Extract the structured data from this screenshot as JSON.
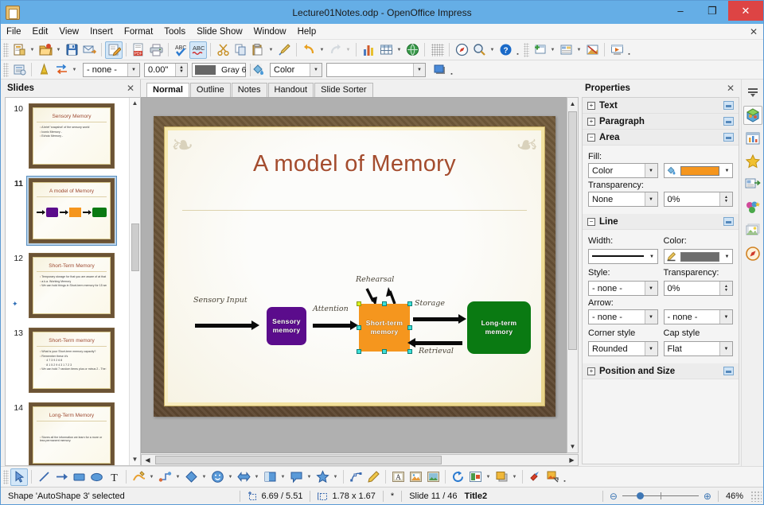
{
  "window": {
    "title": "Lecture01Notes.odp - OpenOffice Impress",
    "app_icon": "impress-icon",
    "minimize": "–",
    "maximize": "❐",
    "close": "✕"
  },
  "menubar": {
    "items": [
      "File",
      "Edit",
      "View",
      "Insert",
      "Format",
      "Tools",
      "Slide Show",
      "Window",
      "Help"
    ],
    "doc_close": "✕"
  },
  "toolbar_standard": {
    "buttons": [
      {
        "name": "new-document",
        "icon": "new-doc-icon",
        "dropdown": true,
        "active": false
      },
      {
        "name": "open-document",
        "icon": "open-folder-icon",
        "dropdown": true,
        "active": false
      },
      {
        "name": "save-document",
        "icon": "save-disk-icon",
        "dropdown": false,
        "active": false
      },
      {
        "name": "email-document",
        "icon": "email-icon",
        "dropdown": false,
        "active": false
      },
      {
        "name": "edit-file",
        "icon": "edit-file-icon",
        "dropdown": false,
        "active": true
      },
      {
        "name": "export-pdf",
        "icon": "pdf-icon",
        "dropdown": false,
        "active": false
      },
      {
        "name": "print-document",
        "icon": "printer-icon",
        "dropdown": false,
        "active": false
      },
      {
        "name": "spelling",
        "icon": "spellcheck-icon",
        "dropdown": false,
        "active": false
      },
      {
        "name": "autospellcheck",
        "icon": "autospell-icon",
        "dropdown": false,
        "active": true
      },
      {
        "name": "cut",
        "icon": "scissors-icon",
        "dropdown": false,
        "active": false
      },
      {
        "name": "copy",
        "icon": "copy-icon",
        "dropdown": false,
        "active": false
      },
      {
        "name": "paste",
        "icon": "paste-icon",
        "dropdown": true,
        "active": false
      },
      {
        "name": "clone-formatting",
        "icon": "paintbrush-icon",
        "dropdown": false,
        "active": false
      },
      {
        "name": "undo",
        "icon": "undo-icon",
        "dropdown": true,
        "active": false
      },
      {
        "name": "redo",
        "icon": "redo-icon",
        "dropdown": true,
        "active": false,
        "disabled": true
      },
      {
        "name": "insert-chart",
        "icon": "chart-icon",
        "dropdown": false,
        "active": false
      },
      {
        "name": "insert-table",
        "icon": "table-icon",
        "dropdown": true,
        "active": false
      },
      {
        "name": "insert-image",
        "icon": "image-globe-icon",
        "dropdown": false,
        "active": false
      },
      {
        "name": "display-grid",
        "icon": "grid-icon",
        "dropdown": false,
        "active": false,
        "disabled": true
      },
      {
        "name": "navigator",
        "icon": "compass-icon",
        "dropdown": false,
        "active": false
      },
      {
        "name": "zoom",
        "icon": "magnifier-icon",
        "dropdown": true,
        "active": false
      },
      {
        "name": "help",
        "icon": "help-icon",
        "dropdown": false,
        "active": false
      },
      {
        "name": "new-slide",
        "icon": "new-slide-icon",
        "dropdown": true,
        "active": false
      },
      {
        "name": "slide-layout",
        "icon": "slide-layout-icon",
        "dropdown": true,
        "active": false
      },
      {
        "name": "slide-design",
        "icon": "slide-design-icon",
        "dropdown": false,
        "active": false
      },
      {
        "name": "start-slideshow",
        "icon": "slideshow-icon",
        "dropdown": false,
        "active": false
      }
    ]
  },
  "toolbar_line_fill": {
    "style_button": "styles-icon",
    "fontwork_button": "fontwork-icon",
    "position_button": "arrange-icon",
    "line_style": "- none -",
    "line_width": "0.00\"",
    "line_color_name": "Gray 6",
    "line_color_hex": "#666666",
    "fill_icon": "bucket-icon",
    "fill_type": "Color",
    "fill_color": "",
    "shadow_button": "shadow-icon"
  },
  "slides_panel": {
    "title": "Slides",
    "close": "✕",
    "scroll_up": "▲",
    "scroll_down": "▼",
    "slides": [
      {
        "number": "10",
        "title": "Sensory Memory",
        "selected": false,
        "type": "bullets",
        "bullets": [
          {
            "text": "A brief 'snapshot' of the sensory world",
            "level": 1
          },
          {
            "text": "Iconic Memory -",
            "level": 1
          },
          {
            "text": "Echoic Memory -",
            "level": 1
          }
        ]
      },
      {
        "number": "11",
        "title": "A model of Memory",
        "selected": true,
        "type": "diagram"
      },
      {
        "number": "12",
        "title": "Short-Term Memory",
        "selected": false,
        "type": "bullets",
        "has_animation": true,
        "bullets": [
          {
            "text": "Temporary storage for that you are aware of at that time.",
            "level": 1
          },
          {
            "text": "a.k.a. Working Memory",
            "level": 1
          },
          {
            "text": "We can hold things in Short-term memory for 15 seconds - if the data is not rehearsed.",
            "level": 1
          }
        ]
      },
      {
        "number": "13",
        "title": "Short-Term memory",
        "selected": false,
        "type": "bullets",
        "bullets": [
          {
            "text": "What is your Short-term memory capacity?",
            "level": 1
          },
          {
            "text": "Remember these #'s",
            "level": 1
          },
          {
            "text": "4 7 3 9 2 6 8",
            "level": 2
          },
          {
            "text": "8 1 5 2 9 4 3 1 7 2 3",
            "level": 2
          },
          {
            "text": "We can hold 7 random items plus or minus 2 - The Magic Number Seven",
            "level": 1
          }
        ]
      },
      {
        "number": "14",
        "title": "Long-Term Memory",
        "selected": false,
        "type": "bullets",
        "bullets": [
          {
            "text": "Stores all the information we learn for a more or less permanent memory.",
            "level": 1
          }
        ]
      }
    ]
  },
  "view_tabs": {
    "tabs": [
      "Normal",
      "Outline",
      "Notes",
      "Handout",
      "Slide Sorter"
    ],
    "active": "Normal"
  },
  "slide_canvas": {
    "title": "A model of Memory",
    "title_color": "#a44c2e",
    "frame_color": "#6b5335",
    "ornament_glyph": "❧",
    "diagram": {
      "boxes": [
        {
          "name": "sensory-memory-box",
          "label": "Sensory memory",
          "color": "#5b0c8c",
          "shape": "rounded"
        },
        {
          "name": "short-term-memory-box",
          "label": "Short-term memory",
          "color": "#f5961e",
          "shape": "rect",
          "selected": true
        },
        {
          "name": "long-term-memory-box",
          "label": "Long-term memory",
          "color": "#0a7a12",
          "shape": "rounded"
        }
      ],
      "labels": [
        {
          "name": "sensory-input-label",
          "text": "Sensory Input"
        },
        {
          "name": "attention-label",
          "text": "Attention"
        },
        {
          "name": "rehearsal-label",
          "text": "Rehearsal"
        },
        {
          "name": "storage-label",
          "text": "Storage"
        },
        {
          "name": "retrieval-label",
          "text": "Retrieval"
        }
      ]
    }
  },
  "properties_sidebar": {
    "title": "Properties",
    "close": "✕",
    "sections": [
      {
        "name": "Text",
        "expanded": false,
        "marker": "+"
      },
      {
        "name": "Paragraph",
        "expanded": false,
        "marker": "+"
      },
      {
        "name": "Area",
        "expanded": true,
        "marker": "−"
      },
      {
        "name": "Line",
        "expanded": true,
        "marker": "−"
      },
      {
        "name": "Position and Size",
        "expanded": false,
        "marker": "+"
      }
    ],
    "area": {
      "fill_label": "Fill:",
      "fill_type": "Color",
      "fill_color_hex": "#f5961e",
      "fill_color_icon": "fill-bucket-icon",
      "transparency_label": "Transparency:",
      "transparency_type": "None",
      "transparency_value": "0%"
    },
    "line": {
      "width_label": "Width:",
      "color_label": "Color:",
      "line_color_hex": "#6e6e6e",
      "line_color_icon": "line-color-pencil-icon",
      "style_label": "Style:",
      "style_value": "- none -",
      "transparency_label": "Transparency:",
      "transparency_value": "0%",
      "arrow_label": "Arrow:",
      "arrow_start": "- none -",
      "arrow_end": "- none -",
      "corner_style_label": "Corner style",
      "corner_style_value": "Rounded",
      "cap_style_label": "Cap style",
      "cap_style_value": "Flat"
    },
    "tabs": [
      {
        "name": "sidebar-settings",
        "icon": "sidebar-menu-icon",
        "active": false
      },
      {
        "name": "properties-tab",
        "icon": "properties-cube-icon",
        "active": true
      },
      {
        "name": "slide-transition-tab",
        "icon": "transition-icon",
        "active": false
      },
      {
        "name": "custom-animation-tab",
        "icon": "star-icon",
        "active": false
      },
      {
        "name": "master-slides-tab",
        "icon": "master-slides-icon",
        "active": false
      },
      {
        "name": "gallery-tab",
        "icon": "gallery-icon",
        "active": false
      },
      {
        "name": "styles-tab",
        "icon": "styles-gallery-icon",
        "active": false
      },
      {
        "name": "navigator-tab",
        "icon": "navigator-compass-icon",
        "active": false
      }
    ]
  },
  "draw_toolbar": {
    "buttons": [
      {
        "name": "select-tool",
        "icon": "cursor-arrow-icon",
        "active": true,
        "dropdown": false
      },
      {
        "name": "line-tool",
        "icon": "line-icon",
        "active": false,
        "dropdown": false
      },
      {
        "name": "arrow-tool",
        "icon": "arrow-icon",
        "active": false,
        "dropdown": false
      },
      {
        "name": "rectangle-tool",
        "icon": "rectangle-icon",
        "active": false,
        "dropdown": false
      },
      {
        "name": "ellipse-tool",
        "icon": "ellipse-icon",
        "active": false,
        "dropdown": false
      },
      {
        "name": "text-tool",
        "icon": "text-T-icon",
        "active": false,
        "dropdown": false
      },
      {
        "name": "curve-tool",
        "icon": "curve-pencil-icon",
        "active": false,
        "dropdown": true
      },
      {
        "name": "connector-tool",
        "icon": "connector-icon",
        "active": false,
        "dropdown": true
      },
      {
        "name": "basic-shapes",
        "icon": "diamond-shape-icon",
        "active": false,
        "dropdown": true
      },
      {
        "name": "symbol-shapes",
        "icon": "smiley-icon",
        "active": false,
        "dropdown": true
      },
      {
        "name": "block-arrows",
        "icon": "block-arrow-icon",
        "active": false,
        "dropdown": true
      },
      {
        "name": "flowchart-shapes",
        "icon": "flowchart-icon",
        "active": false,
        "dropdown": true
      },
      {
        "name": "callout-shapes",
        "icon": "callout-icon",
        "active": false,
        "dropdown": true
      },
      {
        "name": "stars-shapes",
        "icon": "star-shape-icon",
        "active": false,
        "dropdown": true
      },
      {
        "name": "points-tool",
        "icon": "edit-points-icon",
        "active": false,
        "dropdown": false
      },
      {
        "name": "glue-points-tool",
        "icon": "glue-points-icon",
        "active": false,
        "dropdown": false
      },
      {
        "name": "fontwork-gallery",
        "icon": "fontwork-A-icon",
        "active": false,
        "dropdown": false
      },
      {
        "name": "insert-image",
        "icon": "insert-image-icon",
        "active": false,
        "dropdown": false
      },
      {
        "name": "insert-media",
        "icon": "insert-media-icon",
        "active": false,
        "dropdown": false
      },
      {
        "name": "rotate-tool",
        "icon": "rotate-icon",
        "active": false,
        "dropdown": false
      },
      {
        "name": "align-objects",
        "icon": "align-icon",
        "active": false,
        "dropdown": true
      },
      {
        "name": "arrange-objects",
        "icon": "arrange-objects-icon",
        "active": false,
        "dropdown": true
      },
      {
        "name": "shadow-tool",
        "icon": "shadow-toggle-icon",
        "active": false,
        "dropdown": false
      },
      {
        "name": "crop-image",
        "icon": "crop-filter-icon",
        "active": false,
        "dropdown": false
      }
    ]
  },
  "statusbar": {
    "selection_info": "Shape 'AutoShape 3' selected",
    "position_icon": "position-icon",
    "position": "6.69 / 5.51",
    "size_icon": "size-icon",
    "size": "1.78 x 1.67",
    "modified": "*",
    "slide_info": "Slide 11 / 46",
    "master_name": "Title2",
    "zoom_out": "⊖",
    "zoom_in": "⊕",
    "zoom_level": "46%"
  }
}
